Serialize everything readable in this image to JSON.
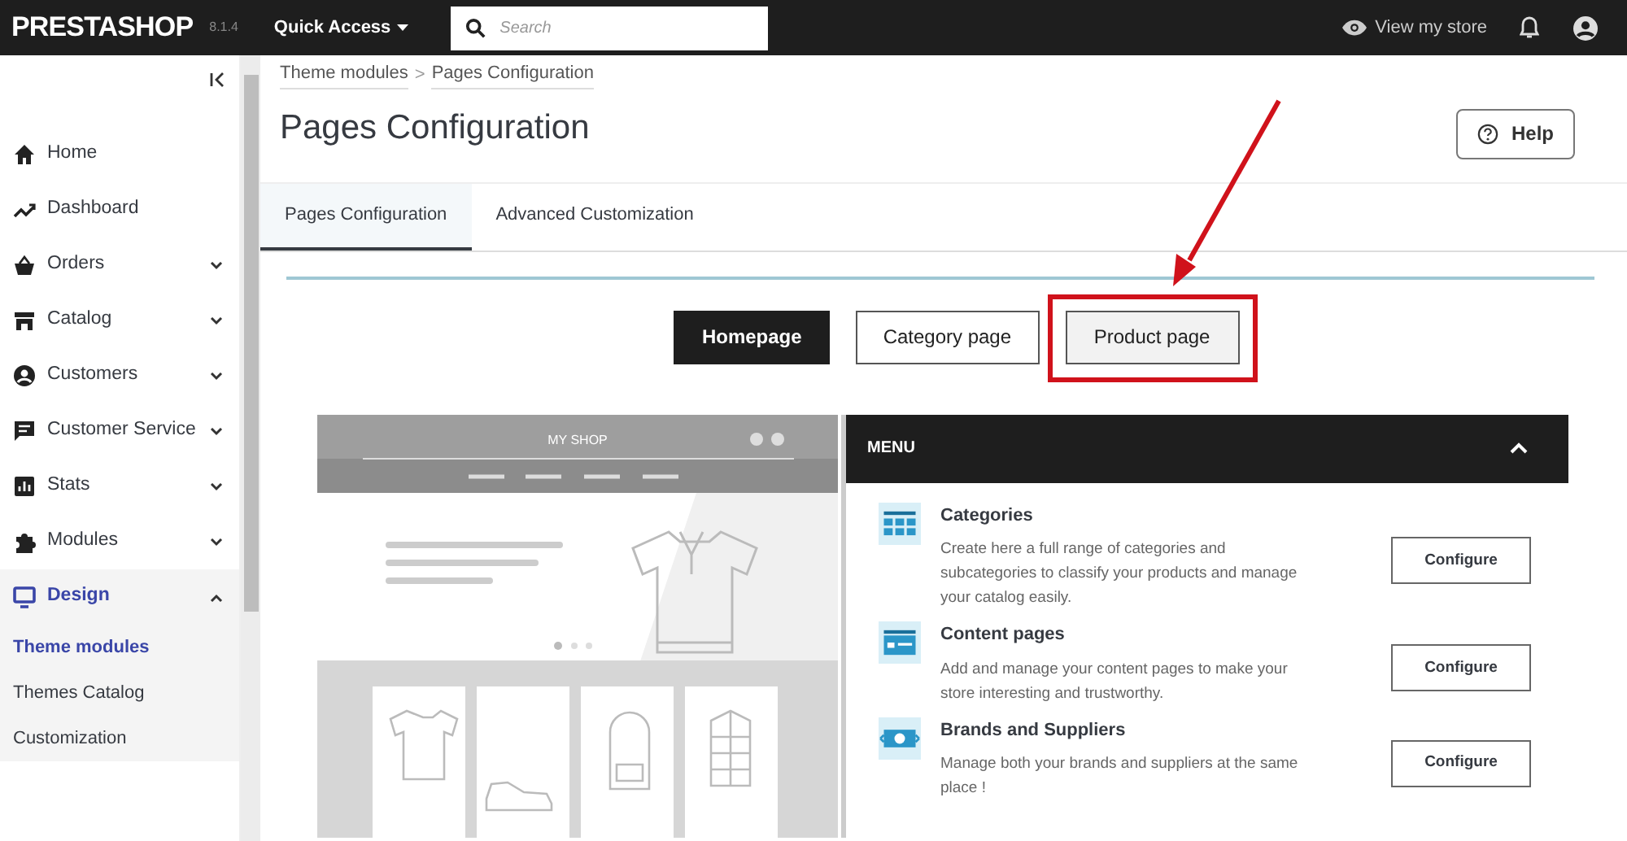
{
  "topbar": {
    "logo": "PRESTASHOP",
    "version": "8.1.4",
    "quick_access": "Quick Access",
    "search": {
      "placeholder": "Search"
    },
    "view_store": "View my store"
  },
  "sidebar": {
    "items": [
      {
        "label": "Home",
        "kind": "link",
        "selected": false
      },
      {
        "label": "Dashboard",
        "kind": "link",
        "selected": false
      },
      {
        "label": "Orders",
        "kind": "group",
        "expanded": false,
        "selected": false
      },
      {
        "label": "Catalog",
        "kind": "group",
        "expanded": false,
        "selected": false
      },
      {
        "label": "Customers",
        "kind": "group",
        "expanded": false,
        "selected": false
      },
      {
        "label": "Customer Service",
        "kind": "group",
        "expanded": false,
        "selected": false
      },
      {
        "label": "Stats",
        "kind": "group",
        "expanded": false,
        "selected": false
      },
      {
        "label": "Modules",
        "kind": "group",
        "expanded": false,
        "selected": false
      },
      {
        "label": "Design",
        "kind": "group",
        "expanded": true,
        "selected": true,
        "children": [
          {
            "label": "Theme modules",
            "selected": true
          },
          {
            "label": "Themes Catalog",
            "selected": false
          },
          {
            "label": "Customization",
            "selected": false
          }
        ]
      }
    ]
  },
  "breadcrumb": [
    "Theme modules",
    "Pages Configuration"
  ],
  "breadcrumb_separator": ">",
  "title": "Pages Configuration",
  "help_button": "Help",
  "tabs": [
    {
      "label": "Pages Configuration",
      "selected": true
    },
    {
      "label": "Advanced Customization",
      "selected": false
    }
  ],
  "page_buttons": [
    {
      "label": "Homepage",
      "selected": true,
      "highlighted": false
    },
    {
      "label": "Category page",
      "selected": false,
      "highlighted": false
    },
    {
      "label": "Product page",
      "selected": false,
      "highlighted": true
    }
  ],
  "preview": {
    "shop_title": "MY SHOP"
  },
  "menu_panel": {
    "title": "MENU",
    "expanded": true,
    "items": [
      {
        "title": "Categories",
        "description": "Create here a full range of categories and subcategories to classify your products and manage your catalog easily.",
        "button": "Configure"
      },
      {
        "title": "Content pages",
        "description": "Add and manage your content pages to make your store interesting and trustworthy.",
        "button": "Configure"
      },
      {
        "title": "Brands and Suppliers",
        "description": "Manage both your brands and suppliers at the same place !",
        "button": "Configure"
      }
    ]
  }
}
